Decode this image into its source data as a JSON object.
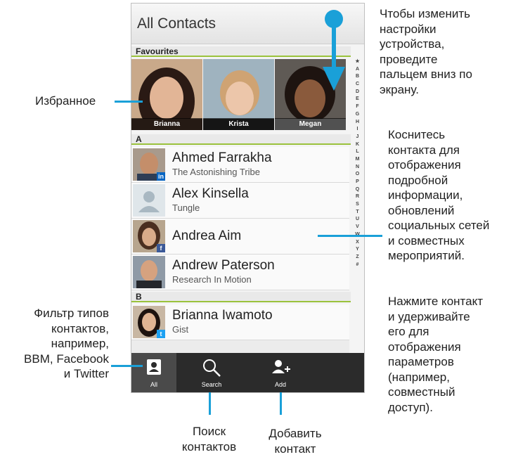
{
  "header": {
    "title": "All Contacts"
  },
  "favourites": {
    "label": "Favourites",
    "items": [
      {
        "name": "Brianna"
      },
      {
        "name": "Krista"
      },
      {
        "name": "Megan"
      }
    ]
  },
  "sections": {
    "a": "A",
    "b": "B"
  },
  "contacts": [
    {
      "name": "Ahmed Farrakha",
      "company": "The Astonishing Tribe",
      "badge": "in"
    },
    {
      "name": "Alex Kinsella",
      "company": "Tungle",
      "badge": ""
    },
    {
      "name": "Andrea Aim",
      "company": "",
      "badge": "f"
    },
    {
      "name": "Andrew Paterson",
      "company": "Research In Motion",
      "badge": ""
    },
    {
      "name": "Brianna Iwamoto",
      "company": "Gist",
      "badge": "t"
    }
  ],
  "index_letters": [
    "★",
    "A",
    "B",
    "C",
    "D",
    "E",
    "F",
    "G",
    "H",
    "I",
    "J",
    "K",
    "L",
    "M",
    "N",
    "O",
    "P",
    "Q",
    "R",
    "S",
    "T",
    "U",
    "V",
    "W",
    "X",
    "Y",
    "Z",
    "#"
  ],
  "actions": {
    "all": "All",
    "search": "Search",
    "add": "Add"
  },
  "annotations": {
    "favourites": "Избранное",
    "settings": [
      "Чтобы изменить",
      "настройки",
      "устройства,",
      "проведите",
      "пальцем вниз по",
      "экрану."
    ],
    "tap_contact": [
      "Коснитесь",
      "контакта для",
      "отображения",
      "подробной",
      "информации,",
      "обновлений",
      "социальных сетей",
      "и совместных",
      "мероприятий."
    ],
    "hold_contact": [
      "Нажмите контакт",
      "и удерживайте",
      "его для",
      "отображения",
      "параметров",
      "(например,",
      "совместный",
      "доступ)."
    ],
    "filter": [
      "Фильтр типов",
      "контактов,",
      "например,",
      "BBM, Facebook",
      "и Twitter"
    ],
    "search": [
      "Поиск",
      "контактов"
    ],
    "add": [
      "Добавить",
      "контакт"
    ]
  },
  "colors": {
    "accent_line": "#1aa0d8",
    "section_underline": "#9ac23c",
    "action_bar": "#2b2b2b"
  }
}
